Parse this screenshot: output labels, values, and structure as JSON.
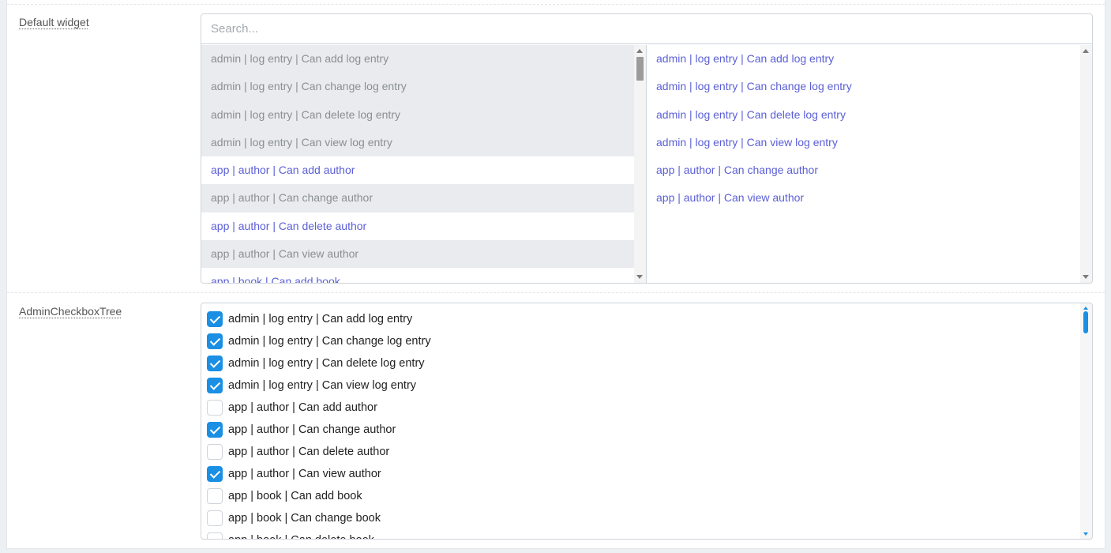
{
  "default_widget": {
    "label": "Default widget",
    "search": {
      "placeholder": "Search...",
      "value": ""
    },
    "available": [
      {
        "label": "admin | log entry | Can add log entry",
        "selected": true
      },
      {
        "label": "admin | log entry | Can change log entry",
        "selected": true
      },
      {
        "label": "admin | log entry | Can delete log entry",
        "selected": true
      },
      {
        "label": "admin | log entry | Can view log entry",
        "selected": true
      },
      {
        "label": "app | author | Can add author",
        "selected": false
      },
      {
        "label": "app | author | Can change author",
        "selected": true
      },
      {
        "label": "app | author | Can delete author",
        "selected": false
      },
      {
        "label": "app | author | Can view author",
        "selected": true
      },
      {
        "label": "app | book | Can add book",
        "selected": false
      }
    ],
    "chosen": [
      "admin | log entry | Can add log entry",
      "admin | log entry | Can change log entry",
      "admin | log entry | Can delete log entry",
      "admin | log entry | Can view log entry",
      "app | author | Can change author",
      "app | author | Can view author"
    ]
  },
  "checkbox_tree": {
    "label": "AdminCheckboxTree",
    "items": [
      {
        "label": "admin | log entry | Can add log entry",
        "checked": true
      },
      {
        "label": "admin | log entry | Can change log entry",
        "checked": true
      },
      {
        "label": "admin | log entry | Can delete log entry",
        "checked": true
      },
      {
        "label": "admin | log entry | Can view log entry",
        "checked": true
      },
      {
        "label": "app | author | Can add author",
        "checked": false
      },
      {
        "label": "app | author | Can change author",
        "checked": true
      },
      {
        "label": "app | author | Can delete author",
        "checked": false
      },
      {
        "label": "app | author | Can view author",
        "checked": true
      },
      {
        "label": "app | book | Can add book",
        "checked": false
      },
      {
        "label": "app | book | Can change book",
        "checked": false
      },
      {
        "label": "app | book | Can delete book",
        "checked": false
      }
    ]
  },
  "colors": {
    "link": "#5b5fd6",
    "selected_bg": "#e9ebee",
    "checkbox_on": "#1a8fe3"
  }
}
